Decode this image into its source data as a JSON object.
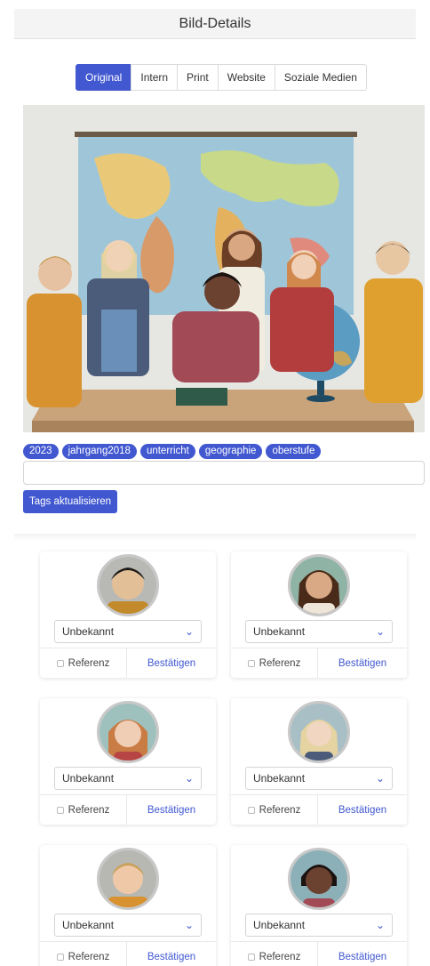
{
  "header": {
    "title": "Bild-Details"
  },
  "tabs": [
    {
      "label": "Original",
      "active": true
    },
    {
      "label": "Intern",
      "active": false
    },
    {
      "label": "Print",
      "active": false
    },
    {
      "label": "Website",
      "active": false
    },
    {
      "label": "Soziale Medien",
      "active": false
    }
  ],
  "tags": [
    "2023",
    "jahrgang2018",
    "unterricht",
    "geographie",
    "oberstufe"
  ],
  "tag_input": {
    "value": ""
  },
  "update_button": "Tags aktualisieren",
  "faces": [
    {
      "select_value": "Unbekannt",
      "reference_label": "Referenz",
      "confirm_label": "Bestätigen"
    },
    {
      "select_value": "Unbekannt",
      "reference_label": "Referenz",
      "confirm_label": "Bestätigen"
    },
    {
      "select_value": "Unbekannt",
      "reference_label": "Referenz",
      "confirm_label": "Bestätigen"
    },
    {
      "select_value": "Unbekannt",
      "reference_label": "Referenz",
      "confirm_label": "Bestätigen"
    },
    {
      "select_value": "Unbekannt",
      "reference_label": "Referenz",
      "confirm_label": "Bestätigen"
    },
    {
      "select_value": "Unbekannt",
      "reference_label": "Referenz",
      "confirm_label": "Bestätigen"
    }
  ],
  "colors": {
    "accent": "#4158d0",
    "header_bg": "#f4f4f4"
  }
}
